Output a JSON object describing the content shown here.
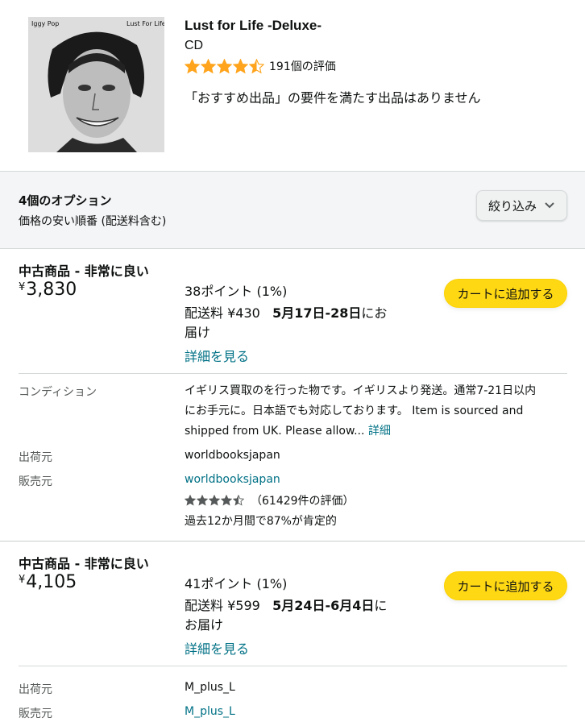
{
  "product": {
    "title": "Lust for Life -Deluxe-",
    "format": "CD",
    "rating_stars": 4.5,
    "rating_count": "191個の評価",
    "no_recommended": "「おすすめ出品」の要件を満たす出品はありません",
    "cover": {
      "artist_text": "Iggy Pop",
      "title_text": "Lust For Life"
    }
  },
  "filter": {
    "option_count": "4個のオプション",
    "sort": "価格の安い順番 (配送料含む)",
    "filter_button": "絞り込み"
  },
  "offers": [
    {
      "condition": "中古商品 - 非常に良い",
      "currency": "¥",
      "price": "3,830",
      "points": "38ポイント (1%)",
      "shipping_prefix": "配送料 ¥430",
      "delivery_dates": "5月17日-28日",
      "delivery_suffix_1": "にお",
      "delivery_suffix_2": "届け",
      "details_link": "詳細を見る",
      "cart_button": "カートに追加する",
      "condition_label": "コンディション",
      "condition_text_1": "イギリス買取のを行った物です。イギリスより発送。通常7-21日以内",
      "condition_text_2": "にお手元に。日本語でも対応しております。 Item is sourced and",
      "condition_text_3": "shipped from UK. Please allow...",
      "condition_more": "詳細",
      "ships_from_label": "出荷元",
      "ships_from": "worldbooksjapan",
      "sold_by_label": "販売元",
      "sold_by": "worldbooksjapan",
      "seller_stars": 4.5,
      "seller_rating_count": "（61429件の評価）",
      "seller_positive": "過去12か月間で87%が肯定的"
    },
    {
      "condition": "中古商品 - 非常に良い",
      "currency": "¥",
      "price": "4,105",
      "points": "41ポイント (1%)",
      "shipping_prefix": "配送料 ¥599",
      "delivery_dates": "5月24日-6月4日",
      "delivery_suffix_1": "に",
      "delivery_suffix_2": "お届け",
      "details_link": "詳細を見る",
      "cart_button": "カートに追加する",
      "ships_from_label": "出荷元",
      "ships_from": "M_plus_L",
      "sold_by_label": "販売元",
      "sold_by": "M_plus_L"
    }
  ],
  "colors": {
    "cart_button": "#ffd814",
    "link": "#007185",
    "star": "#ffa41c",
    "seller_star": "#565959"
  }
}
